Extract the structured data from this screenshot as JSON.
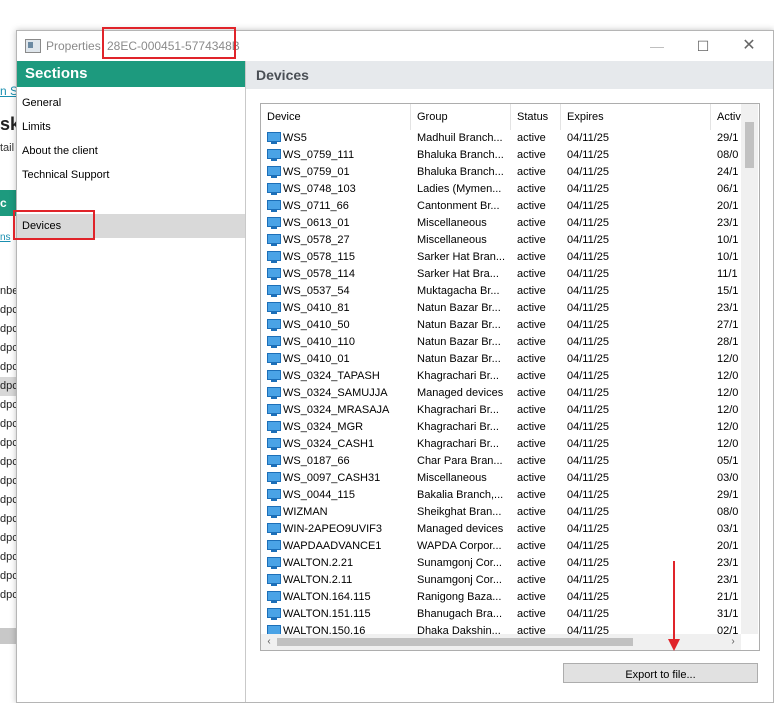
{
  "background_app": {
    "link_text": "n S",
    "big_text": "sky",
    "small_text": "tail",
    "teal_text": "c",
    "link2_text": "ns",
    "rows": [
      "nbe",
      "dpc",
      "dpc",
      "dpc",
      "dpc",
      "dpc",
      "dpc",
      "dpc",
      "dpc",
      "dpc",
      "dpc",
      "dpc",
      "dpc",
      "dpc",
      "dpc",
      "dpc",
      "dpc"
    ]
  },
  "window": {
    "title": "Properties",
    "client_id": "28EC-000451-5774348B",
    "minimize_icon": "minimize-icon",
    "maximize_icon": "maximize-icon",
    "close_icon": "close-icon",
    "maximize_glyph": "☐",
    "close_glyph": "✕",
    "minimize_glyph": "—"
  },
  "sidebar": {
    "header": "Sections",
    "items": [
      {
        "label": "General"
      },
      {
        "label": "Limits"
      },
      {
        "label": "About the client"
      },
      {
        "label": "Technical Support"
      },
      {
        "label": "Devices",
        "selected": true
      }
    ]
  },
  "content": {
    "title": "Devices",
    "columns": [
      "Device",
      "Group",
      "Status",
      "Expires",
      "Activ"
    ],
    "rows": [
      {
        "device": "WS5",
        "group": "Madhuil Branch...",
        "status": "active",
        "expires": "04/11/25",
        "activ": "29/1"
      },
      {
        "device": "WS_0759_111",
        "group": "Bhaluka Branch...",
        "status": "active",
        "expires": "04/11/25",
        "activ": "08/0"
      },
      {
        "device": "WS_0759_01",
        "group": "Bhaluka Branch...",
        "status": "active",
        "expires": "04/11/25",
        "activ": "24/1"
      },
      {
        "device": "WS_0748_103",
        "group": "Ladies (Mymen...",
        "status": "active",
        "expires": "04/11/25",
        "activ": "06/1"
      },
      {
        "device": "WS_0711_66",
        "group": "Cantonment Br...",
        "status": "active",
        "expires": "04/11/25",
        "activ": "20/1"
      },
      {
        "device": "WS_0613_01",
        "group": "Miscellaneous",
        "status": "active",
        "expires": "04/11/25",
        "activ": "23/1"
      },
      {
        "device": "WS_0578_27",
        "group": "Miscellaneous",
        "status": "active",
        "expires": "04/11/25",
        "activ": "10/1"
      },
      {
        "device": "WS_0578_115",
        "group": "Sarker Hat Bran...",
        "status": "active",
        "expires": "04/11/25",
        "activ": "10/1"
      },
      {
        "device": "WS_0578_114",
        "group": "Sarker Hat Bra...",
        "status": "active",
        "expires": "04/11/25",
        "activ": "11/1"
      },
      {
        "device": "WS_0537_54",
        "group": "Muktagacha Br...",
        "status": "active",
        "expires": "04/11/25",
        "activ": "15/1"
      },
      {
        "device": "WS_0410_81",
        "group": "Natun Bazar Br...",
        "status": "active",
        "expires": "04/11/25",
        "activ": "23/1"
      },
      {
        "device": "WS_0410_50",
        "group": "Natun Bazar Br...",
        "status": "active",
        "expires": "04/11/25",
        "activ": "27/1"
      },
      {
        "device": "WS_0410_110",
        "group": "Natun Bazar Br...",
        "status": "active",
        "expires": "04/11/25",
        "activ": "28/1"
      },
      {
        "device": "WS_0410_01",
        "group": "Natun Bazar Br...",
        "status": "active",
        "expires": "04/11/25",
        "activ": "12/0"
      },
      {
        "device": "WS_0324_TAPASH",
        "group": "Khagrachari Br...",
        "status": "active",
        "expires": "04/11/25",
        "activ": "12/0"
      },
      {
        "device": "WS_0324_SAMUJJA",
        "group": "Managed devices",
        "status": "active",
        "expires": "04/11/25",
        "activ": "12/0"
      },
      {
        "device": "WS_0324_MRASAJA",
        "group": "Khagrachari Br...",
        "status": "active",
        "expires": "04/11/25",
        "activ": "12/0"
      },
      {
        "device": "WS_0324_MGR",
        "group": "Khagrachari Br...",
        "status": "active",
        "expires": "04/11/25",
        "activ": "12/0"
      },
      {
        "device": "WS_0324_CASH1",
        "group": "Khagrachari Br...",
        "status": "active",
        "expires": "04/11/25",
        "activ": "12/0"
      },
      {
        "device": "WS_0187_66",
        "group": "Char Para Bran...",
        "status": "active",
        "expires": "04/11/25",
        "activ": "05/1"
      },
      {
        "device": "WS_0097_CASH31",
        "group": "Miscellaneous",
        "status": "active",
        "expires": "04/11/25",
        "activ": "03/0"
      },
      {
        "device": "WS_0044_115",
        "group": "Bakalia Branch,...",
        "status": "active",
        "expires": "04/11/25",
        "activ": "29/1"
      },
      {
        "device": "WIZMAN",
        "group": "Sheikghat Bran...",
        "status": "active",
        "expires": "04/11/25",
        "activ": "08/0"
      },
      {
        "device": "WIN-2APEO9UVIF3",
        "group": "Managed devices",
        "status": "active",
        "expires": "04/11/25",
        "activ": "03/1"
      },
      {
        "device": "WAPDAADVANCE1",
        "group": "WAPDA Corpor...",
        "status": "active",
        "expires": "04/11/25",
        "activ": "20/1"
      },
      {
        "device": "WALTON.2.21",
        "group": "Sunamgonj Cor...",
        "status": "active",
        "expires": "04/11/25",
        "activ": "23/1"
      },
      {
        "device": "WALTON.2.11",
        "group": "Sunamgonj Cor...",
        "status": "active",
        "expires": "04/11/25",
        "activ": "23/1"
      },
      {
        "device": "WALTON.164.115",
        "group": "Ranigong Baza...",
        "status": "active",
        "expires": "04/11/25",
        "activ": "21/1"
      },
      {
        "device": "WALTON.151.115",
        "group": "Bhanugach Bra...",
        "status": "active",
        "expires": "04/11/25",
        "activ": "31/1"
      },
      {
        "device": "WALTON.150.16",
        "group": "Dhaka Dakshin...",
        "status": "active",
        "expires": "04/11/25",
        "activ": "02/1"
      }
    ],
    "export_label": "Export to file...",
    "scroll_left_glyph": "‹",
    "scroll_right_glyph": "›",
    "device_icon": "monitor-icon"
  },
  "colors": {
    "accent": "#1d9a7e",
    "annotation": "#e0242a",
    "selected": "#d9d9d9"
  }
}
